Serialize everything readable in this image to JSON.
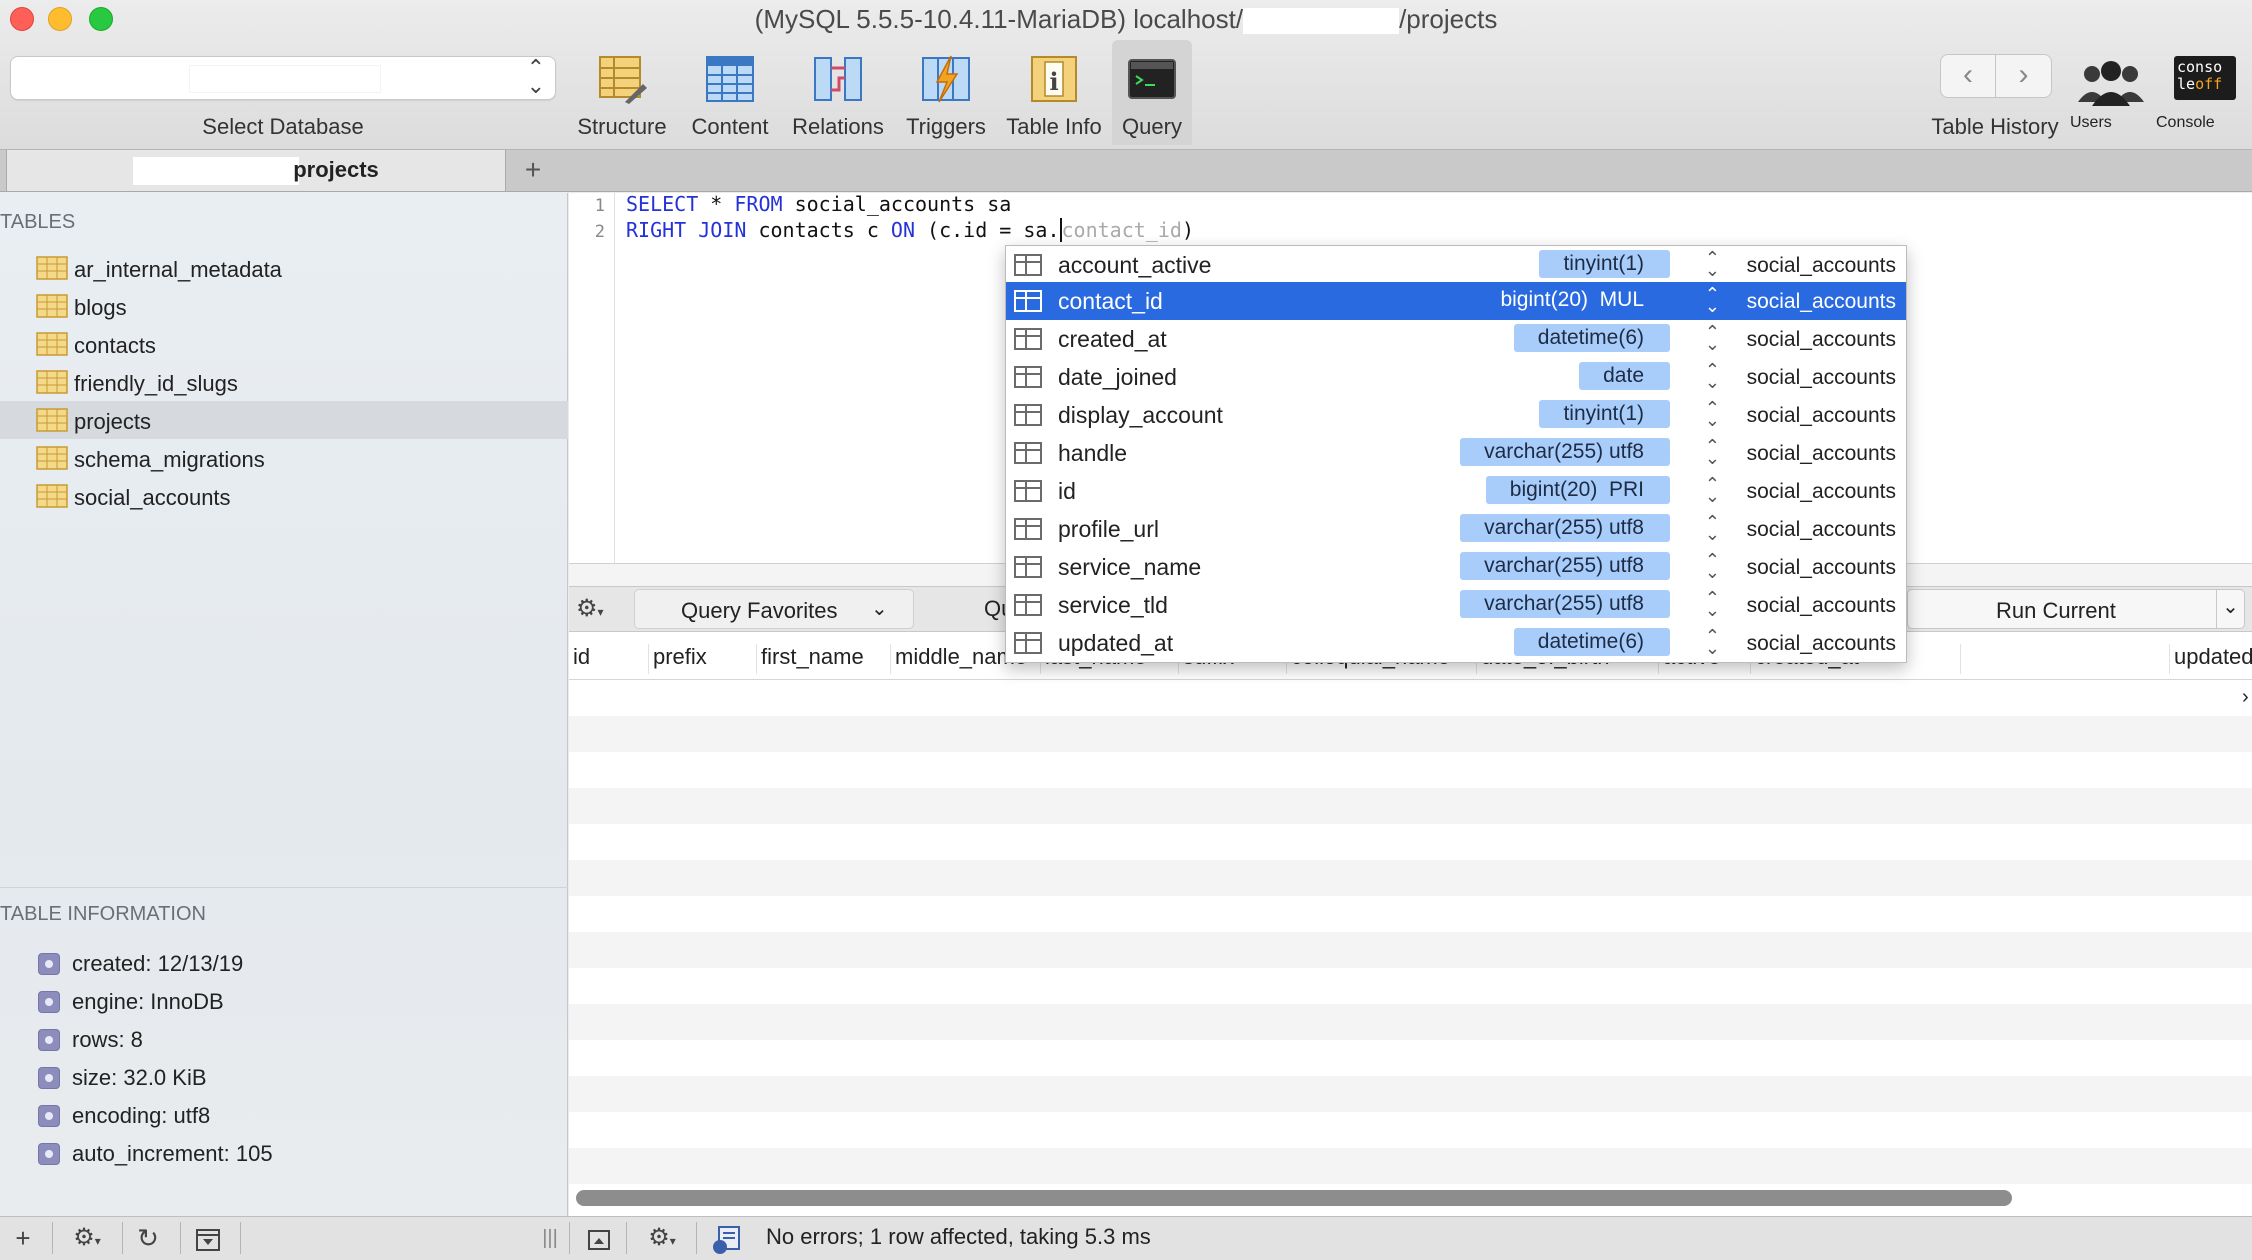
{
  "window": {
    "title_prefix": "(MySQL 5.5.5-10.4.11-MariaDB) localhost/",
    "title_suffix": "/projects"
  },
  "db_selector": {
    "label": "Select Database"
  },
  "toolbar": {
    "structure": "Structure",
    "content": "Content",
    "relations": "Relations",
    "triggers": "Triggers",
    "table_info": "Table Info",
    "query": "Query",
    "table_history": "Table History",
    "users": "Users",
    "console": "Console"
  },
  "tab": {
    "label_suffix": "projects",
    "add": "+"
  },
  "sidebar": {
    "tables_header": "TABLES",
    "tables": [
      "ar_internal_metadata",
      "blogs",
      "contacts",
      "friendly_id_slugs",
      "projects",
      "schema_migrations",
      "social_accounts"
    ],
    "selected_table": "projects",
    "info_header": "TABLE INFORMATION",
    "info": [
      "created: 12/13/19",
      "engine: InnoDB",
      "rows: 8",
      "size: 32.0 KiB",
      "encoding: utf8",
      "auto_increment: 105"
    ]
  },
  "editor": {
    "line1_num": "1",
    "line2_num": "2",
    "line1": {
      "kw1": "SELECT",
      "rest1": " * ",
      "kw2": "FROM",
      "rest2": " social_accounts sa"
    },
    "line2": {
      "kw1": "RIGHT JOIN",
      "rest1": " contacts c ",
      "kw2": "ON",
      "rest2": " (c.id = sa.",
      "ghost": "contact_id",
      "end": ")"
    }
  },
  "querybar": {
    "favorites": "Query Favorites",
    "history_partial": "Qu",
    "run_current": "Run Current"
  },
  "grid": {
    "columns": [
      "id",
      "prefix",
      "first_name",
      "middle_name",
      "last_name",
      "suffix",
      "colloquial_name",
      "date_of_birth",
      "active",
      "created_at",
      "updated"
    ]
  },
  "autocomplete": {
    "rows": [
      {
        "name": "account_active",
        "type": "tinyint(1)",
        "table": "social_accounts"
      },
      {
        "name": "contact_id",
        "type": "bigint(20)  MUL",
        "table": "social_accounts"
      },
      {
        "name": "created_at",
        "type": "datetime(6)",
        "table": "social_accounts"
      },
      {
        "name": "date_joined",
        "type": "date",
        "table": "social_accounts"
      },
      {
        "name": "display_account",
        "type": "tinyint(1)",
        "table": "social_accounts"
      },
      {
        "name": "handle",
        "type": "varchar(255) utf8",
        "table": "social_accounts"
      },
      {
        "name": "id",
        "type": "bigint(20)  PRI",
        "table": "social_accounts"
      },
      {
        "name": "profile_url",
        "type": "varchar(255) utf8",
        "table": "social_accounts"
      },
      {
        "name": "service_name",
        "type": "varchar(255) utf8",
        "table": "social_accounts"
      },
      {
        "name": "service_tld",
        "type": "varchar(255) utf8",
        "table": "social_accounts"
      },
      {
        "name": "updated_at",
        "type": "datetime(6)",
        "table": "social_accounts"
      }
    ],
    "selected_index": 1
  },
  "status": {
    "message": "No errors; 1 row affected, taking 5.3 ms"
  },
  "colors": {
    "accent": "#2a6ae0",
    "type_badge": "#a9cdfa",
    "keyword": "#2432d8"
  }
}
